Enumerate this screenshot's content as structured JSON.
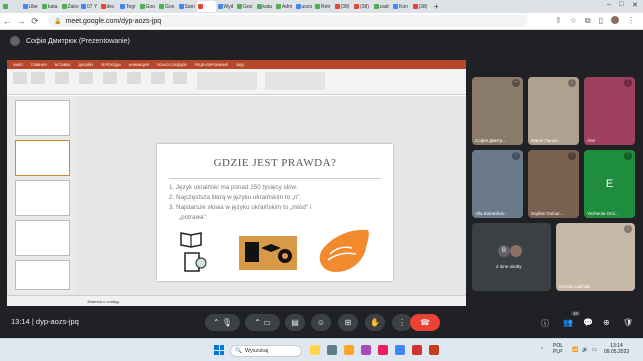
{
  "browser": {
    "tabs": [
      {
        "label": "",
        "color": "#4caf50"
      },
      {
        "label": "Ube",
        "color": "#4285f4"
      },
      {
        "label": "kata",
        "color": "#4caf50"
      },
      {
        "label": "Zako",
        "color": "#4caf50"
      },
      {
        "label": "07 Y",
        "color": "#4285f4"
      },
      {
        "label": "dec",
        "color": "#ea4335"
      },
      {
        "label": "Tegr",
        "color": "#4285f4"
      },
      {
        "label": "Goo",
        "color": "#4caf50"
      },
      {
        "label": "Goo",
        "color": "#4caf50"
      },
      {
        "label": "Sam",
        "color": "#4285f4"
      },
      {
        "label": "",
        "color": "#ea4335"
      },
      {
        "label": "Wyd",
        "color": "#4285f4"
      },
      {
        "label": "Goo",
        "color": "#4caf50"
      },
      {
        "label": "kata",
        "color": "#4caf50"
      },
      {
        "label": "Adm",
        "color": "#4caf50"
      },
      {
        "label": "uozo",
        "color": "#4285f4"
      },
      {
        "label": "Retr",
        "color": "#4caf50"
      },
      {
        "label": "(38)",
        "color": "#ea4335"
      },
      {
        "label": "(38)",
        "color": "#ea4335"
      },
      {
        "label": "zadr",
        "color": "#4caf50"
      },
      {
        "label": "Kon",
        "color": "#4285f4"
      },
      {
        "label": "(38)",
        "color": "#ea4335"
      }
    ],
    "url": "meet.google.com/dyp-aozs-jpq"
  },
  "meet": {
    "presenter_label": "Софія Дмитрюк (Prezentowanie)",
    "meeting_time": "13:14",
    "meeting_code": "dyp-aozs-jpq",
    "participant_count": "10"
  },
  "slide": {
    "title": "GDZIE JEST PRAWDA?",
    "bullets": [
      "Język ukraiński ma ponad 250 tysięcy słów.",
      "Najczęstsza literą w języku ukraińskim to „п\".",
      "Najstarsze słowa w języku ukraińskim to „miód\" i",
      "„potrawa\"."
    ],
    "numbers": [
      "1.",
      "2.",
      "3.",
      ""
    ],
    "status_text": "Заметки к слайду"
  },
  "participants": [
    {
      "name": "Софія Дмитр...",
      "bg": "#8a7a6a"
    },
    {
      "name": "Марія Панов...",
      "bg": "#b0a090"
    },
    {
      "name": "Ann",
      "bg": "#a04060"
    },
    {
      "name": "Alla Bołotnikov...",
      "bg": "#6a7a8a"
    },
    {
      "name": "Sophie Golour...",
      "bg": "#7a6050"
    },
    {
      "name": "Yevhenia Omi...",
      "bg": "#1e8e3e",
      "initial": "E"
    },
    {
      "name": "2 inne osoby",
      "bg": "#3c4043",
      "initial": "B"
    },
    {
      "name": "Dorota Lubiński",
      "bg": "#c8b8a8"
    }
  ],
  "taskbar": {
    "search_placeholder": "Wyszukaj",
    "lang": "POL",
    "lang2": "PLP",
    "time": "13:14",
    "date": "09.05.2023"
  }
}
